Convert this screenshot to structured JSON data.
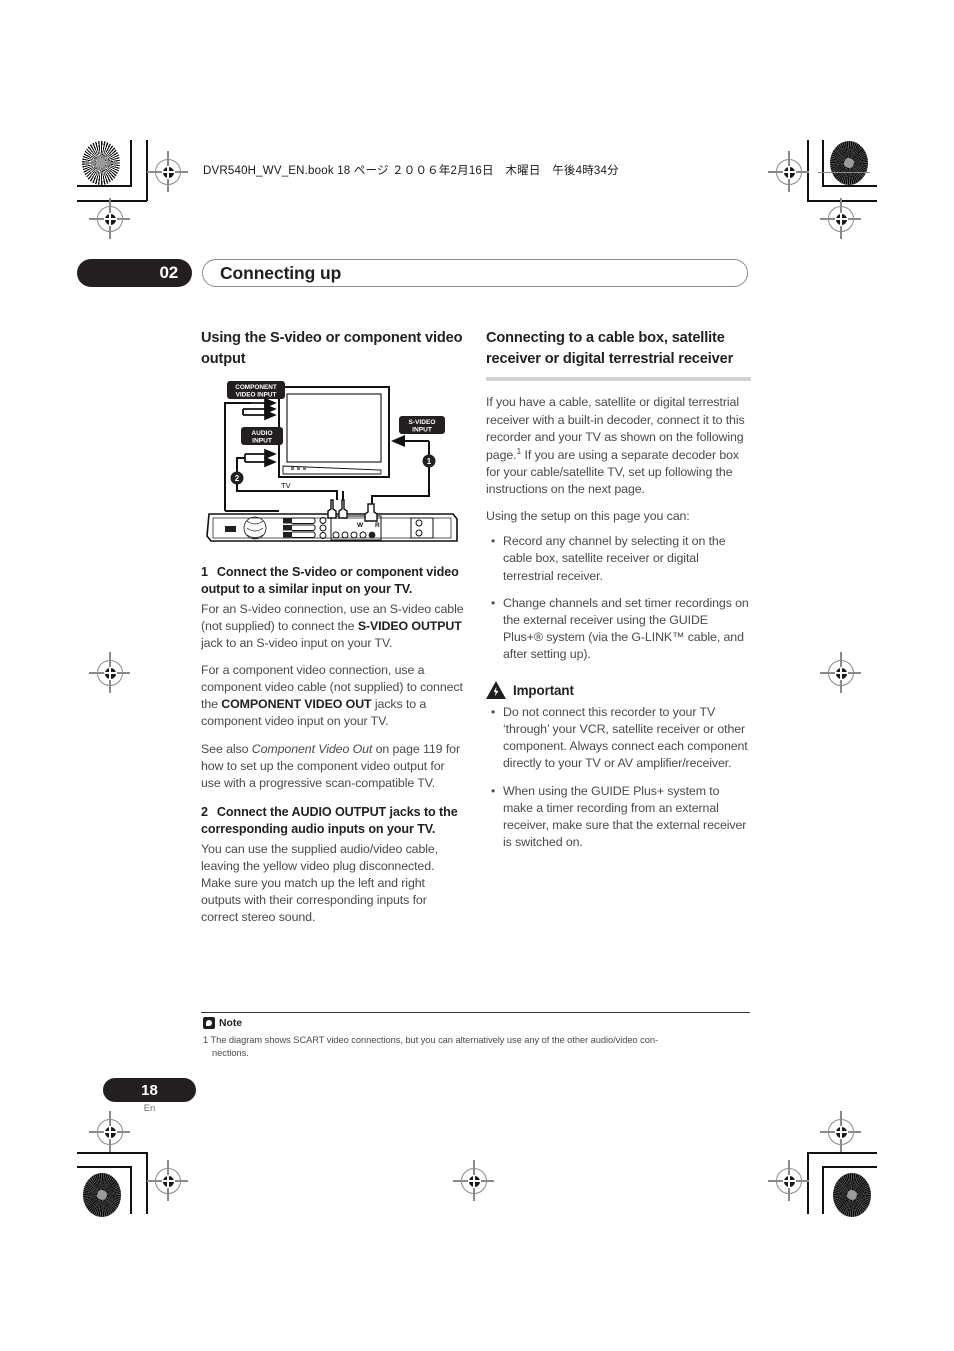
{
  "header": {
    "book_line": "DVR540H_WV_EN.book 18 ページ ２００６年2月16日　木曜日　午後4時34分"
  },
  "chapter": {
    "number": "02",
    "title": "Connecting up"
  },
  "left_column": {
    "heading": "Using the S-video or component video output",
    "diagram": {
      "labels": {
        "component_video_input": "COMPONENT VIDEO INPUT",
        "audio_input": "AUDIO INPUT",
        "s_video_input": "S-VIDEO INPUT",
        "tv": "TV",
        "callout_1": "1",
        "callout_2": "2"
      }
    },
    "step1": {
      "number": "1",
      "title": "Connect the S-video or component video output to a similar input on your TV.",
      "p1_a": "For an S-video connection, use an S-video cable (not supplied) to connect the ",
      "p1_b": "S-VIDEO OUTPUT",
      "p1_c": " jack to an S-video input on your TV.",
      "p2_a": "For a component video connection, use a component video cable (not supplied) to connect the ",
      "p2_b": "COMPONENT VIDEO OUT",
      "p2_c": " jacks to a component video input on your TV.",
      "p3_a": "See also ",
      "p3_b": "Component Video Out",
      "p3_c": " on page 119 for how to set up the component video output for use with a progressive scan-compatible TV."
    },
    "step2": {
      "number": "2",
      "title": "Connect the AUDIO OUTPUT jacks to the corresponding audio inputs on your TV.",
      "p1": "You can use the supplied audio/video cable, leaving the yellow video plug disconnected. Make sure you match up the left and right outputs with their corresponding inputs for correct stereo sound."
    }
  },
  "right_column": {
    "heading": "Connecting to a cable box, satellite receiver or digital terrestrial receiver",
    "intro_a": "If you have a cable, satellite or digital terrestrial receiver with a built-in decoder, connect it to this recorder and your TV as shown on the following page.",
    "intro_fn": "1",
    "intro_b": " If you are using a separate decoder box for your cable/satellite TV, set up following the instructions on the next page.",
    "setup_lead": "Using the setup on this page you can:",
    "setup_bullets": [
      "Record any channel by selecting it on the cable box, satellite receiver or digital terrestrial receiver.",
      "Change channels and set timer recordings on the external receiver using the GUIDE Plus+® system (via the G-LINK™ cable, and after setting up)."
    ],
    "important": {
      "title": "Important",
      "bullets": [
        "Do not connect this recorder to your TV ‘through’ your VCR, satellite receiver or other component. Always connect each component directly to your TV or AV amplifier/receiver.",
        "When using the GUIDE Plus+ system to make a timer recording from an external receiver, make sure that the external receiver is switched on."
      ]
    }
  },
  "footnote": {
    "label": "Note",
    "text": "1 The diagram shows SCART video connections, but you can alternatively use any of the other audio/video con-",
    "text_cont": "nections."
  },
  "footer": {
    "page_number": "18",
    "language": "En"
  },
  "colors": {
    "ink": "#231f20",
    "body_text": "#4b4b4b",
    "rule": "#d2d2d2"
  }
}
